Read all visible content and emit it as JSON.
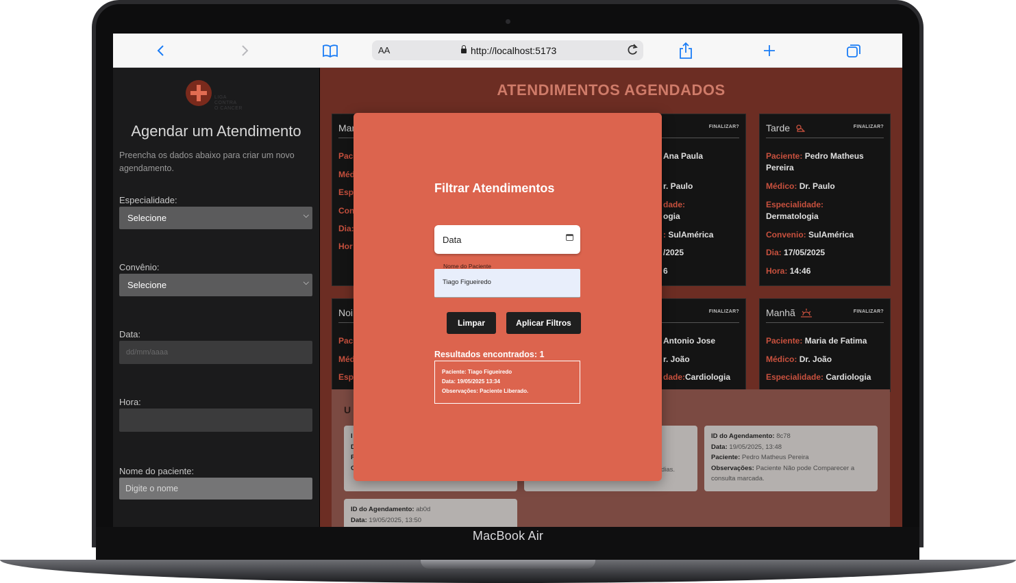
{
  "device": {
    "label": "MacBook Air"
  },
  "browser": {
    "aa_label": "AA",
    "url": "http://localhost:5173",
    "icons": [
      "chevron-left-icon",
      "chevron-right-icon",
      "bookmarks-icon",
      "lock-icon",
      "reload-icon",
      "share-icon",
      "plus-icon",
      "tabs-icon"
    ]
  },
  "sidebar": {
    "logo_text": "LIGA\nCONTRA\nO CANCER",
    "title": "Agendar um Atendimento",
    "subtitle": "Preencha os dados abaixo para criar um novo agendamento.",
    "especialidade_label": "Especialidade:",
    "especialidade_value": "Selecione",
    "convenio_label": "Convênio:",
    "convenio_value": "Selecione",
    "data_label": "Data:",
    "data_placeholder": "dd/mm/aaaa",
    "hora_label": "Hora:",
    "nome_label": "Nome do paciente:",
    "nome_placeholder": "Digite o nome"
  },
  "main": {
    "title": "ATENDIMENTOS AGENDADOS",
    "finalizar": "FINALIZAR?",
    "cards": [
      {
        "period": "Manhã",
        "visible_left": "Mar",
        "rows": [
          "Pac",
          "Méd",
          "Esp",
          "Con",
          "Dia:",
          "Hor"
        ]
      },
      {
        "rows": [
          {
            "v": "Ana Paula"
          },
          {
            "v": "r. Paulo"
          },
          {
            "k": "dade:"
          },
          {
            "v": "ogia"
          },
          {
            "k": ":",
            "v": "SulAmérica"
          },
          {
            "v": "/2025"
          },
          {
            "v": "6"
          }
        ]
      },
      {
        "period": "Tarde",
        "rows": [
          {
            "k": "Paciente:",
            "v": "Pedro Matheus Pereira"
          },
          {
            "k": "Médico:",
            "v": "Dr. Paulo"
          },
          {
            "k": "Especialidade:",
            "v": "Dermatologia"
          },
          {
            "k": "Convenio:",
            "v": "SulAmérica"
          },
          {
            "k": "Dia:",
            "v": "17/05/2025"
          },
          {
            "k": "Hora:",
            "v": "14:46"
          }
        ]
      },
      {
        "visible_left": "Noi",
        "rows": [
          "Pac",
          "Méd",
          "Esp"
        ]
      },
      {
        "rows": [
          {
            "v": "Antonio Jose"
          },
          {
            "v": "r. João"
          },
          {
            "k": "dade:",
            "v": "Cardiologia"
          }
        ]
      },
      {
        "period": "Manhã",
        "rows": [
          {
            "k": "Paciente:",
            "v": "Maria de Fatima"
          },
          {
            "k": "Médico:",
            "v": "Dr. João"
          },
          {
            "k": "Especialidade:",
            "v": "Cardiologia"
          }
        ]
      }
    ],
    "updates_title_partial": "U",
    "notes": [
      {
        "lines": [
          "I",
          "D",
          "P",
          "O"
        ]
      },
      {
        "tail": "dias."
      },
      {
        "id_label": "ID do Agendamento:",
        "id": "8c78",
        "data_label": "Data:",
        "data": "19/05/2025, 13:48",
        "paciente_label": "Paciente:",
        "paciente": "Pedro Matheus Pereira",
        "obs_label": "Observações:",
        "obs": "Paciente Não pode Comparecer a consulta marcada."
      },
      {
        "id_label": "ID do Agendamento:",
        "id": "ab0d",
        "data_label": "Data:",
        "data": "19/05/2025, 13:50"
      }
    ]
  },
  "modal": {
    "title": "Filtrar Atendimentos",
    "date_label": "Data",
    "name_label": "Nome do Paciente",
    "name_value": "Tiago Figueiredo",
    "clear_button": "Limpar",
    "apply_button": "Aplicar Filtros",
    "results_label": "Resultados encontrados: 1",
    "result": {
      "paciente": "Paciente: Tiago Figueiredo",
      "data": "Data: 19/05/2025 13:34",
      "obs": "Observações: Paciente Liberado."
    }
  }
}
